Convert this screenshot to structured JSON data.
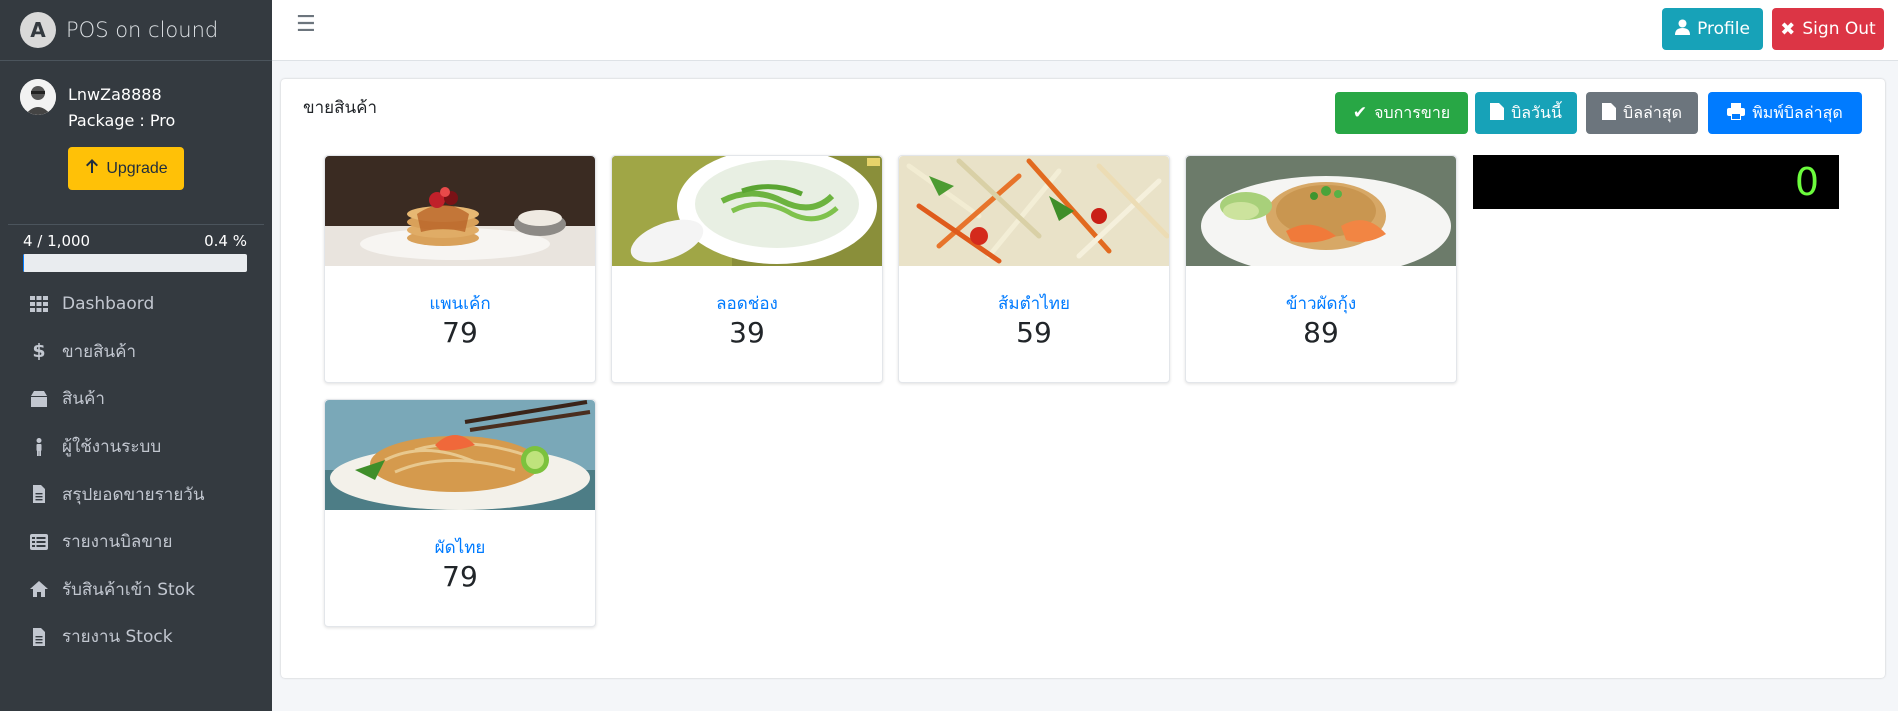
{
  "app": {
    "brand": "POS on clound",
    "logo_letter": "A"
  },
  "user": {
    "name": "LnwZa8888",
    "package": "Package : Pro",
    "upgrade_label": "Upgrade"
  },
  "usage": {
    "count": "4 / 1,000",
    "percent": "0.4 %",
    "fraction": 0.004
  },
  "sidebar": {
    "items": [
      {
        "label": "Dashbaord",
        "icon": "grid-icon"
      },
      {
        "label": "ขายสินค้า",
        "icon": "dollar-icon"
      },
      {
        "label": "สินค้า",
        "icon": "box-icon"
      },
      {
        "label": "ผู้ใช้งานระบบ",
        "icon": "person-icon"
      },
      {
        "label": "สรุปยอดขายรายวัน",
        "icon": "file-icon"
      },
      {
        "label": "รายงานบิลขาย",
        "icon": "list-icon"
      },
      {
        "label": "รับสินค้าเข้า Stok",
        "icon": "home-icon"
      },
      {
        "label": "รายงาน Stock",
        "icon": "file-icon"
      }
    ]
  },
  "topbar": {
    "profile_label": "Profile",
    "signout_label": "Sign Out"
  },
  "sale": {
    "title": "ขายสินค้า",
    "actions": {
      "end_sale": "จบการขาย",
      "bill_today": "บิลวันนี้",
      "last_bill": "บิลล่าสุด",
      "print_last_bill": "พิมพ์บิลล่าสุด"
    },
    "total_display": "0",
    "products": [
      {
        "name": "แพนเค้ก",
        "price": "79"
      },
      {
        "name": "ลอดช่อง",
        "price": "39"
      },
      {
        "name": "ส้มตำไทย",
        "price": "59"
      },
      {
        "name": "ข้าวผัดกุ้ง",
        "price": "89"
      },
      {
        "name": "ผัดไทย",
        "price": "79"
      }
    ]
  },
  "colors": {
    "sidebar_bg": "#343a40",
    "upgrade": "#ffc107",
    "profile": "#17a2b8",
    "signout": "#dc3545",
    "end_sale": "#28a745",
    "bill_today": "#17a2b8",
    "last_bill": "#6c757d",
    "print": "#007bff",
    "display_text": "#6cfc3d"
  }
}
